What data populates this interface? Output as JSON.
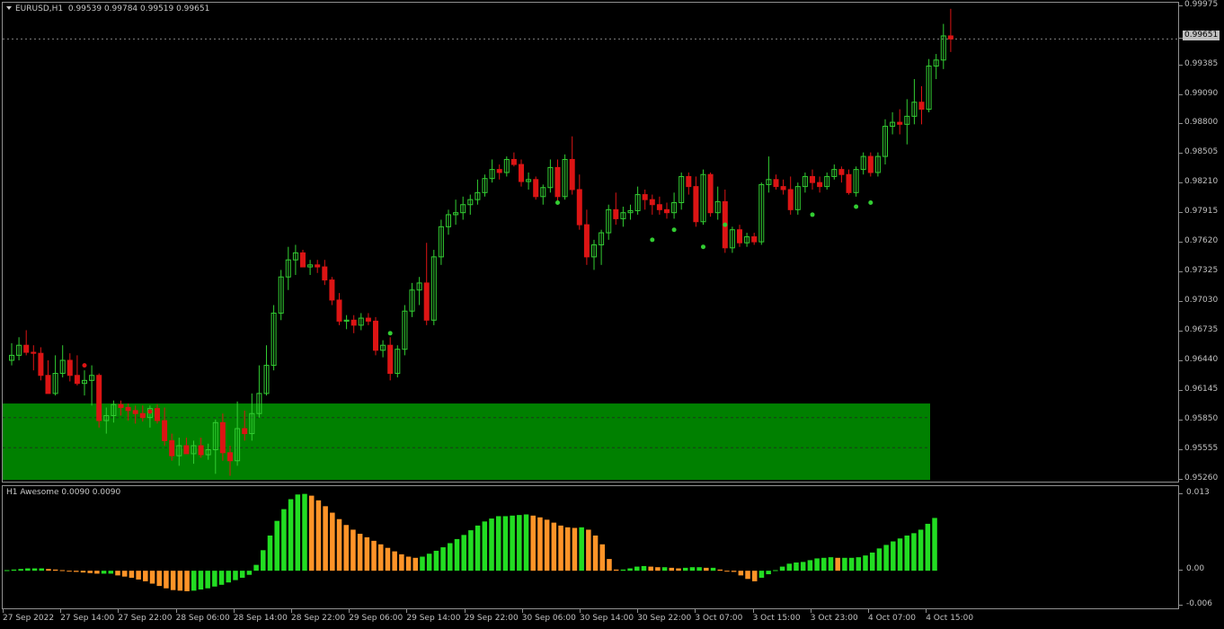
{
  "chart": {
    "title_symbol": "EURUSD,H1",
    "title_values": "0.99539 0.99784 0.99519 0.99651",
    "last_price_label": "0.99651",
    "indicator_label": "H1 Awesome 0.0090 0.0090"
  },
  "colors": {
    "background": "#000000",
    "bull": "#32cd32",
    "bear": "#dc1414",
    "zone": "#008000",
    "fractal": "#32cd32",
    "ao_up": "#22dd22",
    "ao_down": "#ff9428"
  },
  "price_axis": [
    "0.99975",
    "0.99651",
    "0.99385",
    "0.99090",
    "0.98800",
    "0.98505",
    "0.98210",
    "0.97915",
    "0.97620",
    "0.97325",
    "0.97030",
    "0.96735",
    "0.96440",
    "0.96145",
    "0.95850",
    "0.95555",
    "0.95260"
  ],
  "osc_axis": [
    "0.013",
    "0.00",
    "-0.006"
  ],
  "time_axis": [
    "27 Sep 2022",
    "27 Sep 14:00",
    "27 Sep 22:00",
    "28 Sep 06:00",
    "28 Sep 14:00",
    "28 Sep 22:00",
    "29 Sep 06:00",
    "29 Sep 14:00",
    "29 Sep 22:00",
    "30 Sep 06:00",
    "30 Sep 14:00",
    "30 Sep 22:00",
    "3 Oct 07:00",
    "3 Oct 15:00",
    "3 Oct 23:00",
    "4 Oct 07:00",
    "4 Oct 15:00"
  ],
  "chart_data": {
    "type": "candlestick",
    "symbol": "EURUSD",
    "timeframe": "H1",
    "ylim": [
      0.9526,
      0.99975
    ],
    "zone": {
      "from": 0.9526,
      "to": 0.9602,
      "dashed_levels": [
        0.9588,
        0.9558
      ]
    },
    "candles": [
      [
        0.9645,
        0.9662,
        0.964,
        0.965
      ],
      [
        0.965,
        0.9668,
        0.9645,
        0.966
      ],
      [
        0.966,
        0.9675,
        0.965,
        0.9653
      ],
      [
        0.9653,
        0.966,
        0.9635,
        0.9652
      ],
      [
        0.9652,
        0.9658,
        0.9625,
        0.963
      ],
      [
        0.963,
        0.9645,
        0.9615,
        0.9612
      ],
      [
        0.9612,
        0.965,
        0.961,
        0.9632
      ],
      [
        0.9632,
        0.966,
        0.9628,
        0.9645
      ],
      [
        0.9645,
        0.9652,
        0.9624,
        0.963
      ],
      [
        0.963,
        0.965,
        0.962,
        0.9622
      ],
      [
        0.9622,
        0.9635,
        0.961,
        0.9625
      ],
      [
        0.9625,
        0.964,
        0.96,
        0.963
      ],
      [
        0.963,
        0.9632,
        0.9578,
        0.9585
      ],
      [
        0.9585,
        0.9598,
        0.9572,
        0.959
      ],
      [
        0.959,
        0.9605,
        0.9583,
        0.9601
      ],
      [
        0.9601,
        0.9605,
        0.959,
        0.9598
      ],
      [
        0.9598,
        0.9602,
        0.9585,
        0.9595
      ],
      [
        0.9595,
        0.96,
        0.9582,
        0.9592
      ],
      [
        0.9592,
        0.96,
        0.9584,
        0.9588
      ],
      [
        0.9588,
        0.96,
        0.9578,
        0.9597
      ],
      [
        0.9597,
        0.9601,
        0.9582,
        0.9585
      ],
      [
        0.9585,
        0.9598,
        0.956,
        0.9565
      ],
      [
        0.9565,
        0.9572,
        0.9545,
        0.955
      ],
      [
        0.955,
        0.9568,
        0.954,
        0.956
      ],
      [
        0.956,
        0.9568,
        0.9552,
        0.9552
      ],
      [
        0.9552,
        0.9565,
        0.9542,
        0.956
      ],
      [
        0.956,
        0.9568,
        0.9548,
        0.9551
      ],
      [
        0.9551,
        0.9562,
        0.9546,
        0.9556
      ],
      [
        0.9556,
        0.9586,
        0.9532,
        0.9583
      ],
      [
        0.9583,
        0.9592,
        0.9545,
        0.9553
      ],
      [
        0.9553,
        0.956,
        0.953,
        0.9545
      ],
      [
        0.9545,
        0.9604,
        0.954,
        0.9577
      ],
      [
        0.9577,
        0.9595,
        0.9565,
        0.9572
      ],
      [
        0.9572,
        0.9612,
        0.9565,
        0.9592
      ],
      [
        0.9592,
        0.964,
        0.9588,
        0.9612
      ],
      [
        0.9612,
        0.966,
        0.961,
        0.964
      ],
      [
        0.964,
        0.97,
        0.9635,
        0.9692
      ],
      [
        0.9692,
        0.9735,
        0.9685,
        0.9728
      ],
      [
        0.9728,
        0.9758,
        0.9715,
        0.9745
      ],
      [
        0.9745,
        0.976,
        0.973,
        0.9752
      ],
      [
        0.9752,
        0.9755,
        0.9738,
        0.9738
      ],
      [
        0.9738,
        0.9745,
        0.973,
        0.974
      ],
      [
        0.974,
        0.9745,
        0.9732,
        0.9738
      ],
      [
        0.9738,
        0.9745,
        0.972,
        0.9725
      ],
      [
        0.9725,
        0.9728,
        0.97,
        0.9705
      ],
      [
        0.9705,
        0.9712,
        0.968,
        0.9684
      ],
      [
        0.9684,
        0.969,
        0.9676,
        0.9685
      ],
      [
        0.9685,
        0.969,
        0.9672,
        0.968
      ],
      [
        0.968,
        0.9692,
        0.9675,
        0.9687
      ],
      [
        0.9687,
        0.9692,
        0.968,
        0.9684
      ],
      [
        0.9684,
        0.9688,
        0.965,
        0.9655
      ],
      [
        0.9655,
        0.9665,
        0.9648,
        0.966
      ],
      [
        0.966,
        0.9668,
        0.9625,
        0.9632
      ],
      [
        0.9632,
        0.966,
        0.9628,
        0.9656
      ],
      [
        0.9656,
        0.97,
        0.965,
        0.9694
      ],
      [
        0.9694,
        0.9722,
        0.9688,
        0.9715
      ],
      [
        0.9715,
        0.9728,
        0.97,
        0.9722
      ],
      [
        0.9722,
        0.9762,
        0.968,
        0.9685
      ],
      [
        0.9685,
        0.9755,
        0.968,
        0.9748
      ],
      [
        0.9748,
        0.9785,
        0.974,
        0.9778
      ],
      [
        0.9778,
        0.9795,
        0.977,
        0.979
      ],
      [
        0.979,
        0.9805,
        0.978,
        0.9792
      ],
      [
        0.9792,
        0.9808,
        0.9785,
        0.98
      ],
      [
        0.98,
        0.981,
        0.979,
        0.9805
      ],
      [
        0.9805,
        0.9825,
        0.98,
        0.9812
      ],
      [
        0.9812,
        0.983,
        0.9808,
        0.9826
      ],
      [
        0.9826,
        0.9845,
        0.9822,
        0.9835
      ],
      [
        0.9835,
        0.984,
        0.9825,
        0.9832
      ],
      [
        0.9832,
        0.9848,
        0.9828,
        0.9845
      ],
      [
        0.9845,
        0.9852,
        0.9838,
        0.984
      ],
      [
        0.984,
        0.9845,
        0.9818,
        0.9823
      ],
      [
        0.9823,
        0.9832,
        0.9815,
        0.9825
      ],
      [
        0.9825,
        0.9828,
        0.9805,
        0.9808
      ],
      [
        0.9808,
        0.982,
        0.98,
        0.9817
      ],
      [
        0.9817,
        0.9845,
        0.9812,
        0.9837
      ],
      [
        0.9837,
        0.9845,
        0.98,
        0.9808
      ],
      [
        0.9808,
        0.985,
        0.9805,
        0.9845
      ],
      [
        0.9845,
        0.9868,
        0.981,
        0.9815
      ],
      [
        0.9815,
        0.983,
        0.9775,
        0.978
      ],
      [
        0.978,
        0.9795,
        0.974,
        0.9748
      ],
      [
        0.9748,
        0.9765,
        0.9735,
        0.976
      ],
      [
        0.976,
        0.9775,
        0.974,
        0.9772
      ],
      [
        0.9772,
        0.98,
        0.9765,
        0.9795
      ],
      [
        0.9795,
        0.9812,
        0.978,
        0.9786
      ],
      [
        0.9786,
        0.9798,
        0.9778,
        0.9792
      ],
      [
        0.9792,
        0.98,
        0.9785,
        0.9794
      ],
      [
        0.9794,
        0.9818,
        0.979,
        0.981
      ],
      [
        0.981,
        0.9815,
        0.9795,
        0.9805
      ],
      [
        0.9805,
        0.981,
        0.979,
        0.98
      ],
      [
        0.98,
        0.9808,
        0.979,
        0.9795
      ],
      [
        0.9795,
        0.9802,
        0.9786,
        0.9792
      ],
      [
        0.9792,
        0.9812,
        0.9786,
        0.9802
      ],
      [
        0.9802,
        0.9832,
        0.9795,
        0.9828
      ],
      [
        0.9828,
        0.9832,
        0.981,
        0.9818
      ],
      [
        0.9818,
        0.9828,
        0.9778,
        0.9783
      ],
      [
        0.9783,
        0.9835,
        0.978,
        0.983
      ],
      [
        0.983,
        0.9832,
        0.9788,
        0.9792
      ],
      [
        0.9792,
        0.9818,
        0.9785,
        0.9803
      ],
      [
        0.9803,
        0.9815,
        0.9752,
        0.9757
      ],
      [
        0.9757,
        0.9778,
        0.9752,
        0.9775
      ],
      [
        0.9775,
        0.978,
        0.9758,
        0.9762
      ],
      [
        0.9762,
        0.9772,
        0.9758,
        0.9768
      ],
      [
        0.9768,
        0.9772,
        0.976,
        0.9763
      ],
      [
        0.9763,
        0.9822,
        0.976,
        0.982
      ],
      [
        0.982,
        0.9848,
        0.9812,
        0.9825
      ],
      [
        0.9825,
        0.983,
        0.9815,
        0.9818
      ],
      [
        0.9818,
        0.9825,
        0.981,
        0.9815
      ],
      [
        0.9815,
        0.9828,
        0.979,
        0.9795
      ],
      [
        0.9795,
        0.9822,
        0.979,
        0.9818
      ],
      [
        0.9818,
        0.9832,
        0.9812,
        0.9828
      ],
      [
        0.9828,
        0.9835,
        0.9815,
        0.9822
      ],
      [
        0.9822,
        0.9828,
        0.9812,
        0.9818
      ],
      [
        0.9818,
        0.9832,
        0.9815,
        0.9828
      ],
      [
        0.9828,
        0.984,
        0.9825,
        0.9835
      ],
      [
        0.9835,
        0.9838,
        0.9822,
        0.983
      ],
      [
        0.983,
        0.9835,
        0.981,
        0.9812
      ],
      [
        0.9812,
        0.9838,
        0.9808,
        0.9835
      ],
      [
        0.9835,
        0.9852,
        0.983,
        0.9848
      ],
      [
        0.9848,
        0.9852,
        0.9828,
        0.9832
      ],
      [
        0.9832,
        0.9852,
        0.9828,
        0.9848
      ],
      [
        0.9848,
        0.9885,
        0.984,
        0.9878
      ],
      [
        0.9878,
        0.9892,
        0.987,
        0.9882
      ],
      [
        0.9882,
        0.9895,
        0.987,
        0.988
      ],
      [
        0.988,
        0.9905,
        0.986,
        0.9888
      ],
      [
        0.9888,
        0.9925,
        0.988,
        0.9902
      ],
      [
        0.9902,
        0.9918,
        0.988,
        0.9895
      ],
      [
        0.9895,
        0.9945,
        0.9892,
        0.9938
      ],
      [
        0.9938,
        0.995,
        0.9925,
        0.9944
      ],
      [
        0.9944,
        0.998,
        0.9935,
        0.9968
      ],
      [
        0.9968,
        0.9995,
        0.9952,
        0.9965
      ]
    ],
    "fractals": [
      [
        10,
        0.964
      ],
      [
        19,
        0.9594
      ],
      [
        52,
        0.9672
      ],
      [
        75,
        0.9802
      ],
      [
        88,
        0.9765
      ],
      [
        91,
        0.9775
      ],
      [
        95,
        0.9758
      ],
      [
        98,
        0.978
      ],
      [
        110,
        0.979
      ],
      [
        116,
        0.9798
      ],
      [
        118,
        0.9802
      ]
    ],
    "awesome_oscillator": [
      0.0001,
      0.0002,
      0.0003,
      0.0004,
      0.0004,
      0.0004,
      0.0003,
      0.0002,
      0.0001,
      0.0,
      -0.0002,
      -0.0003,
      -0.0004,
      -0.0005,
      -0.0005,
      -0.0005,
      -0.0008,
      -0.001,
      -0.0012,
      -0.0015,
      -0.0018,
      -0.0022,
      -0.0026,
      -0.003,
      -0.0033,
      -0.0034,
      -0.0035,
      -0.0034,
      -0.0032,
      -0.003,
      -0.0027,
      -0.0024,
      -0.002,
      -0.0016,
      -0.0012,
      -0.0007,
      0.001,
      0.0035,
      0.006,
      0.0085,
      0.0105,
      0.0122,
      0.013,
      0.0131,
      0.0128,
      0.012,
      0.011,
      0.0099,
      0.0088,
      0.0078,
      0.007,
      0.0063,
      0.0057,
      0.0051,
      0.0045,
      0.0039,
      0.0033,
      0.0028,
      0.0024,
      0.0022,
      0.0024,
      0.0029,
      0.0034,
      0.004,
      0.0047,
      0.0054,
      0.0061,
      0.0069,
      0.0077,
      0.0084,
      0.0089,
      0.0093,
      0.0093,
      0.0094,
      0.0095,
      0.0096,
      0.0094,
      0.0091,
      0.0087,
      0.0082,
      0.0077,
      0.0074,
      0.0073,
      0.0074,
      0.007,
      0.006,
      0.0045,
      0.002,
      0.0002,
      0.0002,
      0.0004,
      0.0007,
      0.0008,
      0.0007,
      0.0006,
      0.0006,
      0.0005,
      0.0004,
      0.0005,
      0.0006,
      0.0006,
      0.0005,
      0.0005,
      0.0002,
      0.0,
      -0.0002,
      -0.0008,
      -0.0014,
      -0.0018,
      -0.0012,
      -0.0006,
      0.0001,
      0.0007,
      0.0012,
      0.0014,
      0.0015,
      0.0018,
      0.0021,
      0.0022,
      0.0023,
      0.0022,
      0.0022,
      0.0022,
      0.0023,
      0.0026,
      0.0031,
      0.0038,
      0.0044,
      0.005,
      0.0055,
      0.006,
      0.0064,
      0.007,
      0.008,
      0.009
    ],
    "osc_ylim": [
      -0.0058,
      0.0132
    ]
  }
}
